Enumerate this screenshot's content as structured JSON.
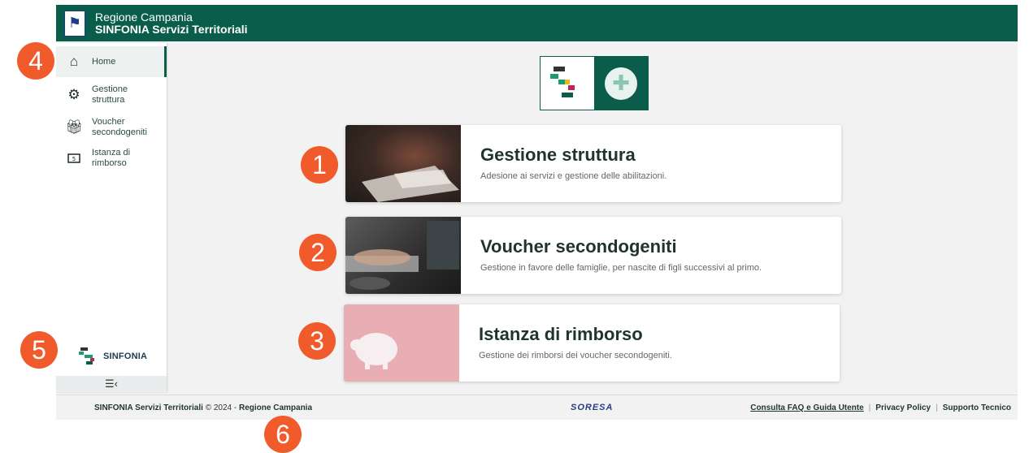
{
  "header": {
    "title_line1": "Regione Campania",
    "title_line2": "SINFONIA Servizi Territoriali",
    "bg_color": "#0b5d4b"
  },
  "sidebar": {
    "items": [
      {
        "label": "Home",
        "icon": "home-icon",
        "active": true
      },
      {
        "label": "Gestione struttura",
        "icon": "gears-icon"
      },
      {
        "label": "Voucher secondogeniti",
        "icon": "gift-icon"
      },
      {
        "label": "Istanza di rimborso",
        "icon": "banknote-icon"
      }
    ],
    "logo_text": "SINFONIA",
    "collapse_icon": "collapse-menu-icon"
  },
  "cards": [
    {
      "title": "Gestione struttura",
      "desc": "Adesione ai servizi e gestione delle abilitazioni."
    },
    {
      "title": "Voucher secondogeniti",
      "desc": "Gestione in favore delle famiglie, per nascite di figli successivi al primo."
    },
    {
      "title": "Istanza di rimborso",
      "desc": "Gestione dei rimborsi dei voucher secondogeniti."
    }
  ],
  "footer": {
    "app_name": "SINFONIA Servizi Territoriali",
    "copyright": "© 2024 -",
    "region": "Regione Campania",
    "partner_logo": "SORESA",
    "links": [
      "Consulta FAQ e Guida Utente",
      "Privacy Policy",
      "Supporto Tecnico"
    ]
  },
  "badges": [
    "1",
    "2",
    "3",
    "4",
    "5",
    "6"
  ],
  "colors": {
    "accent": "#0b5d4b",
    "badge": "#f15a2b"
  }
}
